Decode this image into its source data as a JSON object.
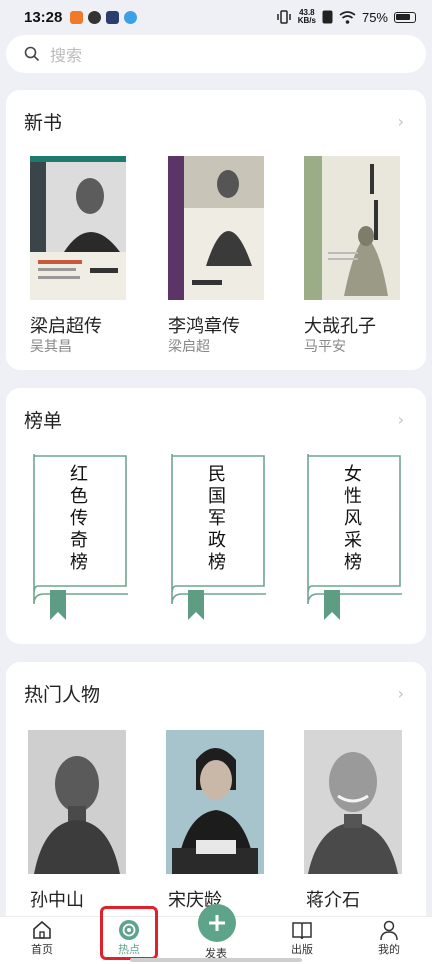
{
  "status_bar": {
    "time": "13:28",
    "net_speed_value": "43.8",
    "net_speed_unit": "KB/s",
    "battery_percent": "75%"
  },
  "search": {
    "placeholder": "搜索"
  },
  "sections": {
    "new_books": {
      "title": "新书",
      "more": "›",
      "books": [
        {
          "name": "梁启超传",
          "author": "吴其昌"
        },
        {
          "name": "李鸿章传",
          "author": "梁启超"
        },
        {
          "name": "大哉孔子",
          "author": "马平安"
        }
      ]
    },
    "rankings": {
      "title": "榜单",
      "more": "›",
      "lists": [
        {
          "name": "红色传奇榜"
        },
        {
          "name": "民国军政榜"
        },
        {
          "name": "女性风采榜"
        }
      ]
    },
    "popular_people": {
      "title": "热门人物",
      "more": "›",
      "people": [
        {
          "name": "孙中山"
        },
        {
          "name": "宋庆龄"
        },
        {
          "name": "蒋介石"
        }
      ]
    }
  },
  "tab_bar": {
    "tabs": [
      {
        "label": "首页",
        "icon": "home-icon"
      },
      {
        "label": "热点",
        "icon": "hot-icon"
      },
      {
        "label": "发表",
        "icon": "plus-icon"
      },
      {
        "label": "出版",
        "icon": "book-icon"
      },
      {
        "label": "我的",
        "icon": "person-icon"
      }
    ],
    "accent": "#5ea48b"
  }
}
